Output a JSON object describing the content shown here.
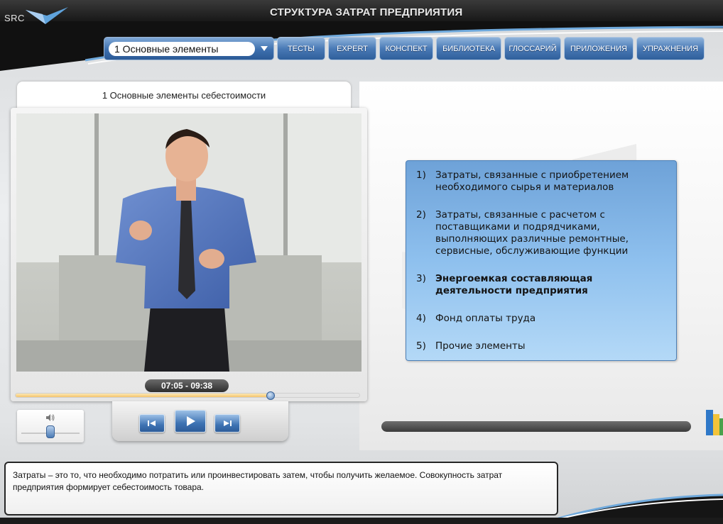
{
  "header": {
    "logo_text": "SRC",
    "title": "СТРУКТУРА ЗАТРАТ ПРЕДПРИЯТИЯ"
  },
  "nav": {
    "select_value": "1 Основные элементы",
    "buttons": [
      "ТЕСТЫ",
      "EXPERT",
      "КОНСПЕКТ",
      "БИБЛИОТЕКА",
      "ГЛОССАРИЙ",
      "ПРИЛОЖЕНИЯ",
      "УПРАЖНЕНИЯ"
    ]
  },
  "video": {
    "title": "1 Основные элементы себестоимости",
    "time": "07:05 - 09:38",
    "progress": 0.7425
  },
  "volume": {
    "level": 0.5
  },
  "content": {
    "items": [
      {
        "num": "1)",
        "text": "Затраты, связанные с приобретением необходимого сырья и материалов",
        "active": false
      },
      {
        "num": "2)",
        "text": "Затраты, связанные с расчетом с поставщиками и подрядчиками, выполняющих различные ремонтные, сервисные, обслуживающие функции",
        "active": false
      },
      {
        "num": "3)",
        "text": "Энергоемкая составляющая деятельности предприятия",
        "active": true
      },
      {
        "num": "4)",
        "text": "Фонд оплаты труда",
        "active": false
      },
      {
        "num": "5)",
        "text": "Прочие элементы",
        "active": false
      }
    ]
  },
  "description": {
    "text": "Затраты – это то, что необходимо потратить или проинвестировать затем, чтобы получить желаемое. Совокупность затрат предприятия формирует себестоимость товара."
  },
  "colors": {
    "accent": "#3d6fae",
    "header": "#0d0d0d",
    "card": "#8ec0ee"
  }
}
